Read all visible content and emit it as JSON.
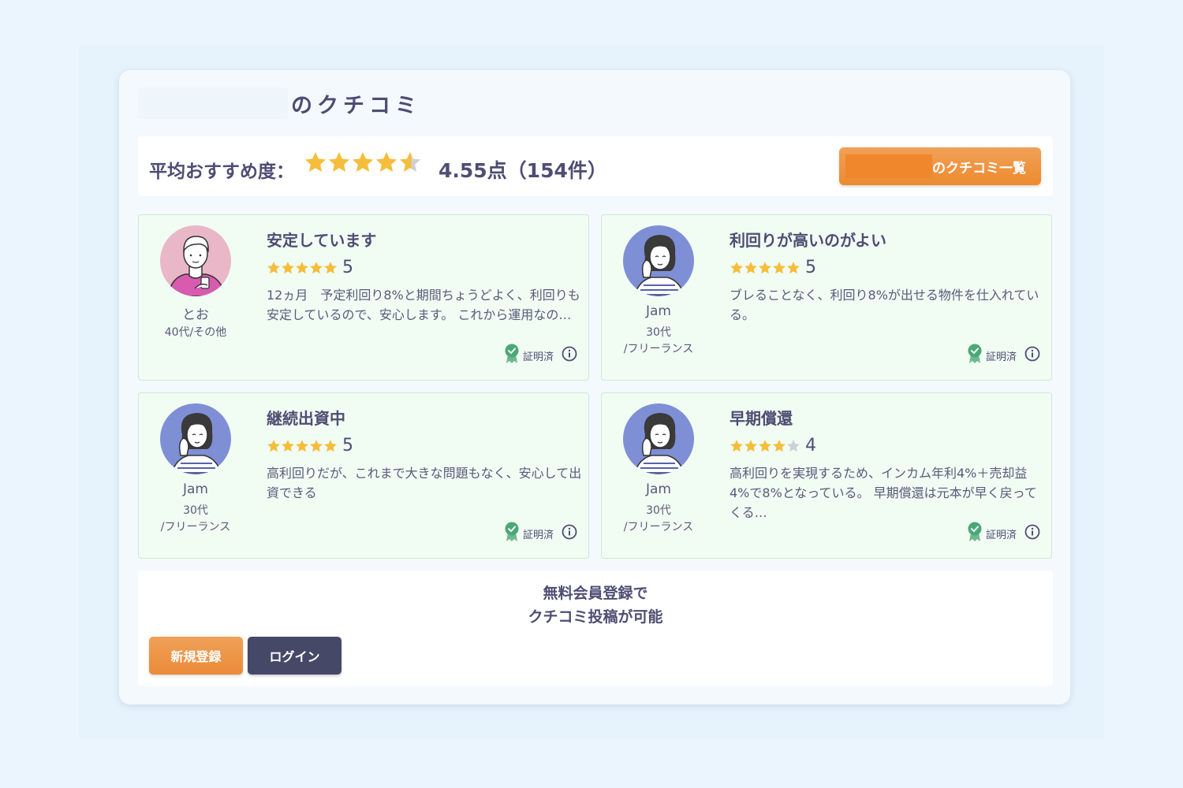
{
  "page": {
    "title": "のクチコミ"
  },
  "summary": {
    "label": "平均おすすめ度：",
    "rating": 4.55,
    "score_text": "4.55点（154件）",
    "list_button": "のクチコミ一覧"
  },
  "reviews": [
    {
      "avatar": "man-pink-avatar-icon",
      "name": "とお",
      "meta": "40代/その他",
      "title": "安定しています",
      "stars": 5,
      "score": "5",
      "body": "12ヵ月　予定利回り8%と期間ちょうどよく、利回りも安定しているので、安心します。 これから運用なの…",
      "verified": "証明済"
    },
    {
      "avatar": "woman-blue-avatar-icon",
      "name": "Jam",
      "meta": "30代\n/フリーランス",
      "title": "利回りが高いのがよい",
      "stars": 5,
      "score": "5",
      "body": "ブレることなく、利回り8%が出せる物件を仕入れている。",
      "verified": "証明済"
    },
    {
      "avatar": "woman-blue-avatar-icon",
      "name": "Jam",
      "meta": "30代\n/フリーランス",
      "title": "継続出資中",
      "stars": 5,
      "score": "5",
      "body": "高利回りだが、これまで大きな問題もなく、安心して出資できる",
      "verified": "証明済"
    },
    {
      "avatar": "woman-blue-avatar-icon",
      "name": "Jam",
      "meta": "30代\n/フリーランス",
      "title": "早期償還",
      "stars": 4,
      "score": "4",
      "body": "高利回りを実現するため、インカム年利4%＋売却益4%で8%となっている。 早期償還は元本が早く戻ってくる…",
      "verified": "証明済"
    }
  ],
  "cta": {
    "line1": "無料会員登録で",
    "line2": "クチコミ投稿が可能",
    "signup_button": "新規登録",
    "login_button": "ログイン"
  },
  "colors": {
    "star": "#f5bd3a",
    "star_empty": "#cfcfd6",
    "accent": "#ee8a2f",
    "dark": "#454866",
    "review_bg": "#f1fcf3",
    "verified": "#4aa877"
  }
}
